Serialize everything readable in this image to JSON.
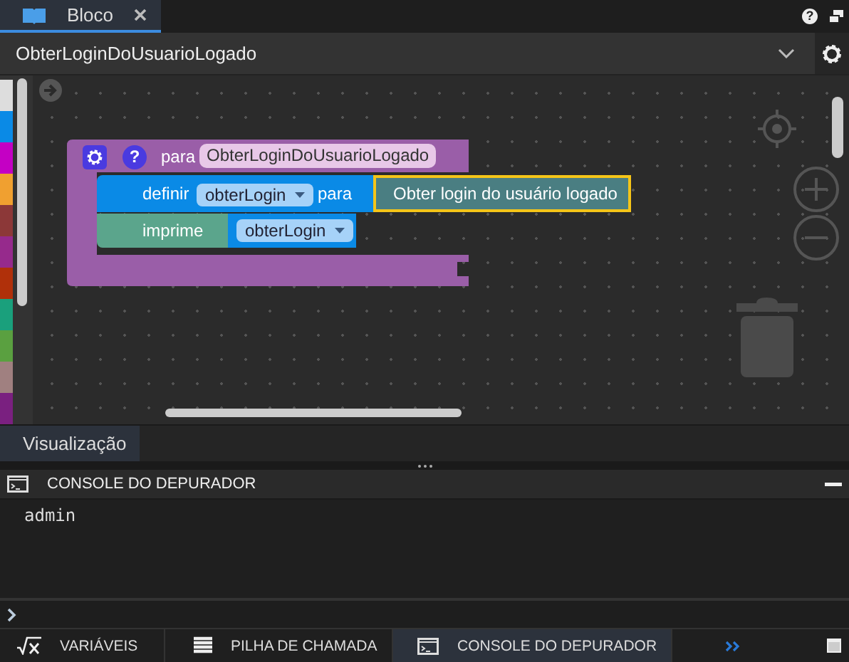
{
  "editor_tab": {
    "label": "Bloco",
    "selected": true
  },
  "help_button": {
    "label": "?"
  },
  "header": {
    "title": "ObterLoginDoUsuarioLogado"
  },
  "toolbox": [
    {
      "color": "#dddddd"
    },
    {
      "color": "#0a8ae6"
    },
    {
      "color": "#c400c4"
    },
    {
      "color": "#f0a030"
    },
    {
      "color": "#8c3838"
    },
    {
      "color": "#962a8c"
    },
    {
      "color": "#b0300a"
    },
    {
      "color": "#1aa07c"
    },
    {
      "color": "#5aa040"
    },
    {
      "color": "#a08080"
    },
    {
      "color": "#7a2080"
    }
  ],
  "blocks": {
    "procedure": {
      "help": "?",
      "keyword": "para",
      "name": "ObterLoginDoUsuarioLogado"
    },
    "set": {
      "keyword": "definir",
      "variable": "obterLogin",
      "connector": "para"
    },
    "value": {
      "text": "Obter login do usuário logado",
      "selected": true
    },
    "print": {
      "keyword": "imprime",
      "variable": "obterLogin"
    }
  },
  "preview_tab": {
    "label": "Visualização",
    "selected": true
  },
  "console": {
    "title": "CONSOLE DO DEPURADOR",
    "output": [
      "admin"
    ]
  },
  "bottom_tabs": [
    {
      "label": "VARIÁVEIS",
      "kind": "variables",
      "selected": false
    },
    {
      "label": "PILHA DE CHAMADA",
      "kind": "stack",
      "selected": false
    },
    {
      "label": "CONSOLE DO DEPURADOR",
      "kind": "console",
      "selected": true
    }
  ]
}
